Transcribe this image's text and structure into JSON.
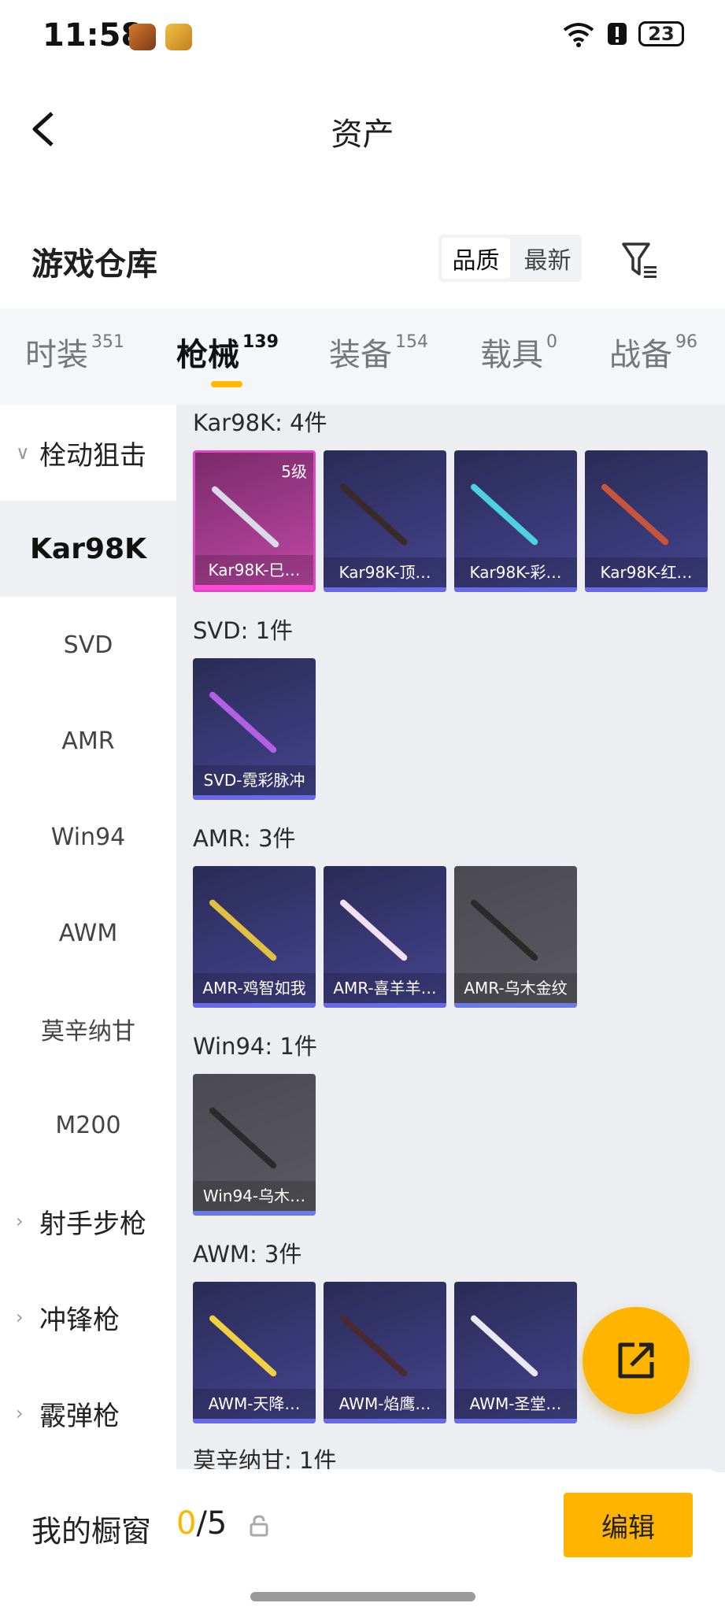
{
  "status": {
    "time": "11:58",
    "battery": "23"
  },
  "header": {
    "title": "资产"
  },
  "section": {
    "title": "游戏仓库",
    "sort_quality": "品质",
    "sort_newest": "最新"
  },
  "tabs": [
    {
      "label": "时装",
      "count": "351"
    },
    {
      "label": "枪械",
      "count": "139"
    },
    {
      "label": "装备",
      "count": "154"
    },
    {
      "label": "载具",
      "count": "0"
    },
    {
      "label": "战备",
      "count": "96"
    }
  ],
  "sidebar": {
    "group1": "栓动狙击",
    "items": [
      "Kar98K",
      "SVD",
      "AMR",
      "Win94",
      "AWM",
      "莫辛纳甘",
      "M200"
    ],
    "groups": [
      "射手步枪",
      "冲锋枪",
      "霰弹枪"
    ]
  },
  "groups": [
    {
      "label": "Kar98K: 4件",
      "cards": [
        {
          "name": "Kar98K-巳…",
          "level": "5级",
          "gun": "#d9d9e8"
        },
        {
          "name": "Kar98K-顶…",
          "gun": "#3a2a2a"
        },
        {
          "name": "Kar98K-彩…",
          "gun": "#4fd0e0"
        },
        {
          "name": "Kar98K-红…",
          "gun": "#c8553a"
        }
      ]
    },
    {
      "label": "SVD: 1件",
      "cards": [
        {
          "name": "SVD-霓彩脉冲",
          "gun": "#b060e0"
        }
      ]
    },
    {
      "label": "AMR: 3件",
      "cards": [
        {
          "name": "AMR-鸡智如我",
          "gun": "#e0c040"
        },
        {
          "name": "AMR-喜羊羊…",
          "gun": "#f0e0f0"
        },
        {
          "name": "AMR-乌木金纹",
          "gun": "#2a2a2a"
        }
      ]
    },
    {
      "label": "Win94: 1件",
      "cards": [
        {
          "name": "Win94-乌木…",
          "gun": "#2a2a2a"
        }
      ]
    },
    {
      "label": "AWM: 3件",
      "cards": [
        {
          "name": "AWM-天降…",
          "gun": "#f0d040"
        },
        {
          "name": "AWM-焰鹰…",
          "gun": "#4a2a30"
        },
        {
          "name": "AWM-圣堂…",
          "gun": "#e8e8f0"
        }
      ]
    },
    {
      "label": "莫辛纳甘: 1件",
      "cards": []
    }
  ],
  "bottom": {
    "title": "我的橱窗",
    "count_used": "0",
    "count_sep": "/5",
    "edit": "编辑"
  }
}
